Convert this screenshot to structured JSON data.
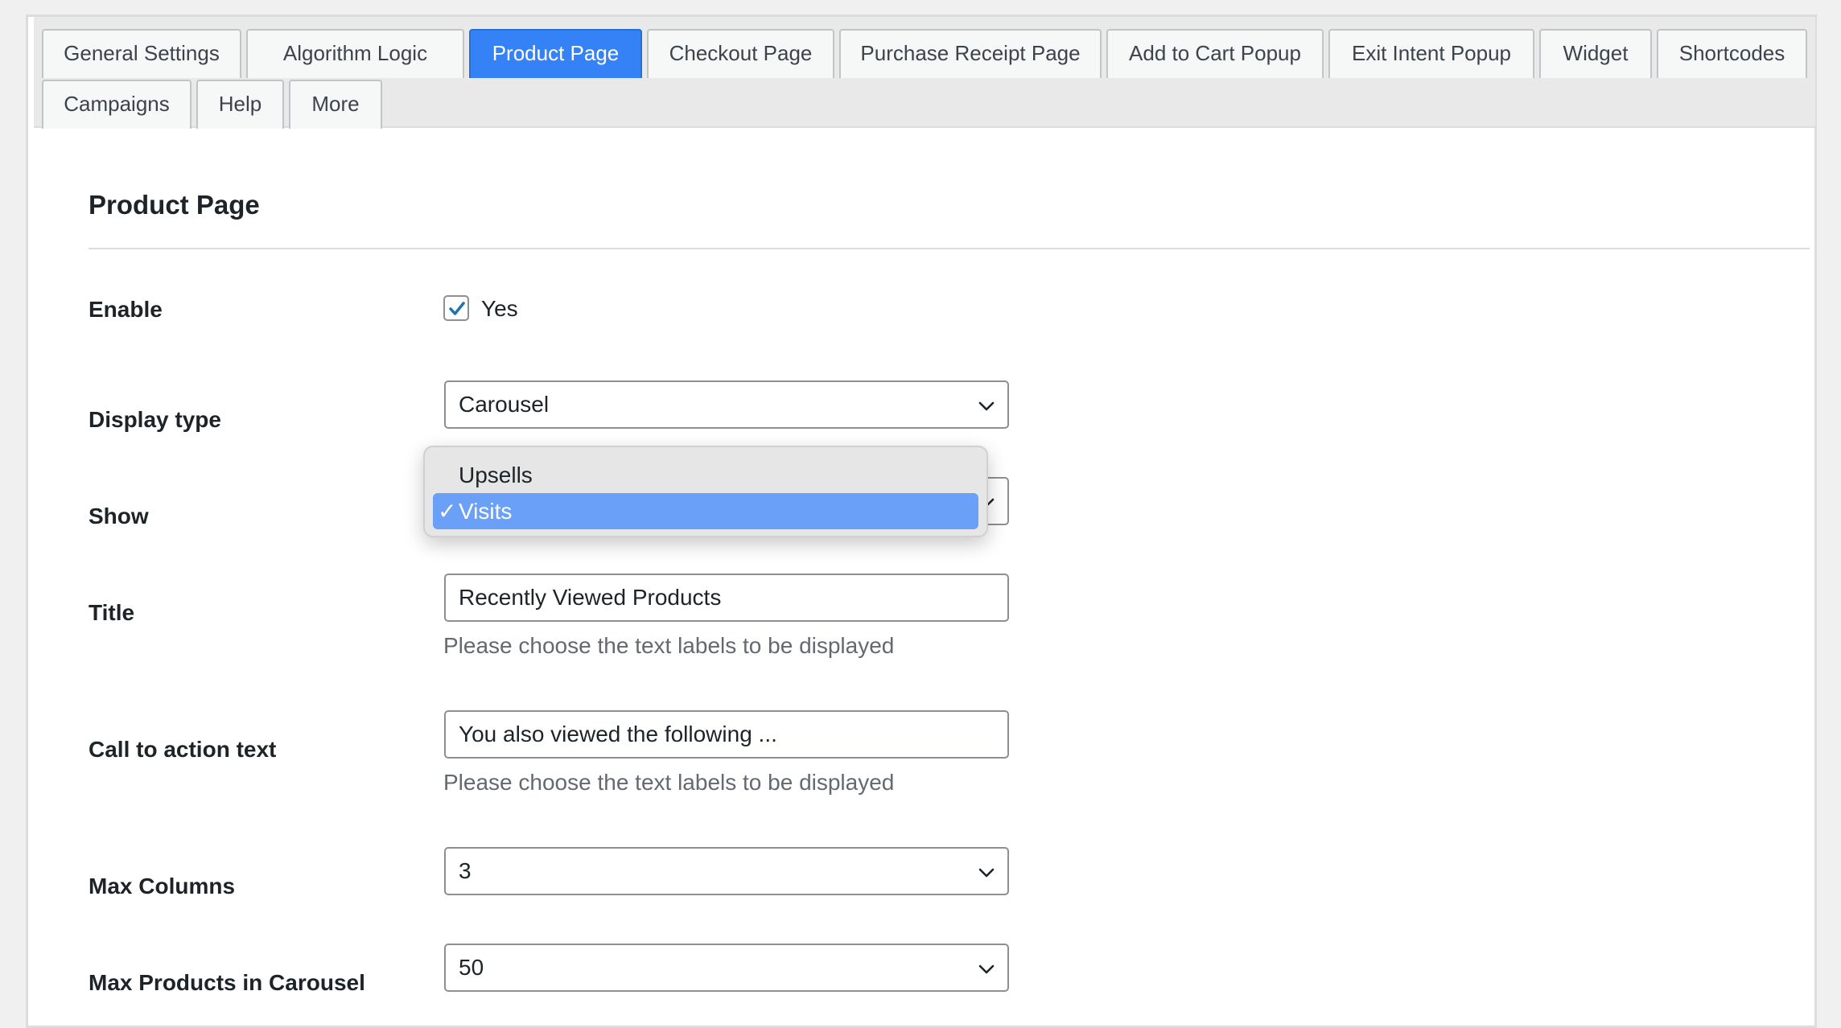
{
  "tabs": {
    "row1": [
      {
        "label": "General Settings",
        "active": false
      },
      {
        "label": "Algorithm Logic",
        "active": false
      },
      {
        "label": "Product Page",
        "active": true
      },
      {
        "label": "Checkout Page",
        "active": false
      },
      {
        "label": "Purchase Receipt Page",
        "active": false
      },
      {
        "label": "Add to Cart Popup",
        "active": false
      },
      {
        "label": "Exit Intent Popup",
        "active": false
      },
      {
        "label": "Widget",
        "active": false
      },
      {
        "label": "Shortcodes",
        "active": false
      }
    ],
    "row2": [
      {
        "label": "Campaigns",
        "active": false
      },
      {
        "label": "Help",
        "active": false
      },
      {
        "label": "More",
        "active": false
      }
    ]
  },
  "section": {
    "title": "Product Page"
  },
  "form": {
    "enable": {
      "label": "Enable",
      "checked": true,
      "option_label": "Yes"
    },
    "display_type": {
      "label": "Display type",
      "value": "Carousel"
    },
    "show": {
      "label": "Show",
      "options": [
        {
          "label": "Upsells",
          "selected": false
        },
        {
          "label": "Visits",
          "selected": true
        }
      ]
    },
    "title": {
      "label": "Title",
      "value": "Recently Viewed Products",
      "description": "Please choose the text labels to be displayed"
    },
    "cta": {
      "label": "Call to action text",
      "value": "You also viewed the following ...",
      "description": "Please choose the text labels to be displayed"
    },
    "max_columns": {
      "label": "Max Columns",
      "value": "3"
    },
    "max_products": {
      "label": "Max Products in Carousel",
      "value": "50"
    }
  },
  "colors": {
    "active_tab": "#3582f6",
    "selected_option": "#6aa0f7",
    "checkbox_tick": "#2271b1"
  },
  "icons": {
    "checkbox": "check-icon",
    "select_arrow": "chevron-down-icon",
    "option_tick": "checkmark-icon"
  }
}
